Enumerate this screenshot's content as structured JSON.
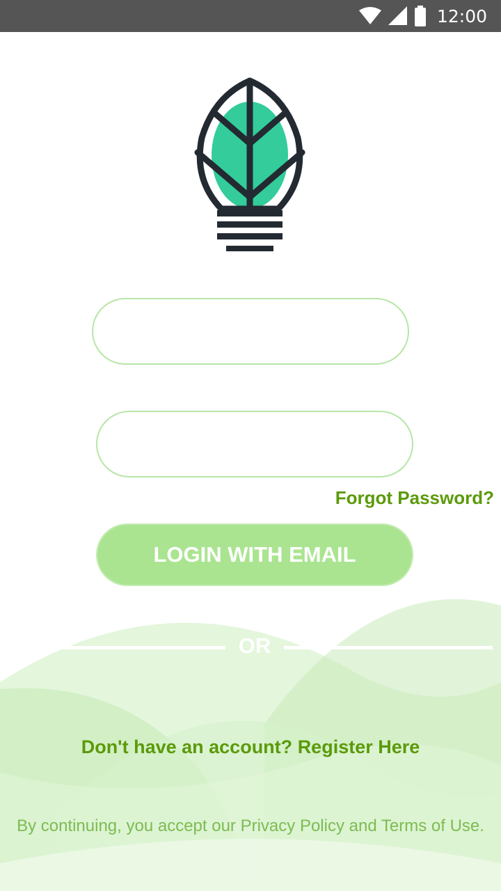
{
  "status_bar": {
    "time": "12:00",
    "icons": [
      "wifi-icon",
      "cell-signal-icon",
      "battery-icon"
    ],
    "background": "#555555"
  },
  "logo": {
    "icon": "leaf-bulb-logo",
    "leaf_color": "#33cc9a",
    "outline_color": "#232a31"
  },
  "login_form": {
    "email_placeholder": "",
    "password_placeholder": "",
    "forgot_password": "Forgot Password?",
    "login_button": "LOGIN WITH EMAIL",
    "or_text": "OR"
  },
  "footer": {
    "register_prompt": "Don't have an account?",
    "register_link": "Register Here",
    "terms": "By continuing, you accept our Privacy Policy and Terms of Use."
  },
  "colors": {
    "accent_green": "#5b9a0a",
    "button_green": "#abe491",
    "input_border": "#b7e6a6",
    "terms_green": "#7dbb52"
  }
}
